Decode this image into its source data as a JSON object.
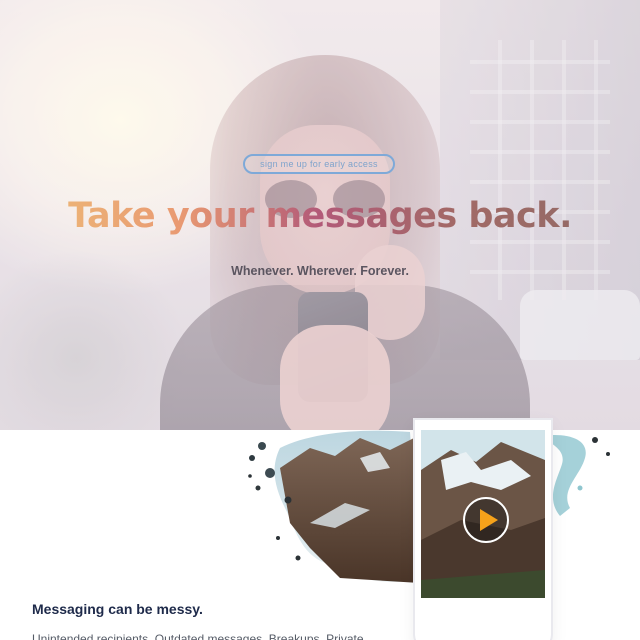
{
  "hero": {
    "cta_label": "sign me up for early access",
    "headline": "Take your messages back.",
    "subheadline": "Whenever. Wherever. Forever."
  },
  "section": {
    "title": "Messaging can be messy.",
    "body": "Unintended recipients. Outdated messages. Breakups. Private"
  },
  "video": {
    "play_icon": "play-icon"
  },
  "colors": {
    "cta_border": "#7ea9d8",
    "headline_gradient": [
      "#eec07a",
      "#e99a72",
      "#b25a78",
      "#8e6a66"
    ],
    "subheadline": "#5b5560",
    "section_title": "#1e2a4a",
    "play_accent": "#f6a21a"
  }
}
